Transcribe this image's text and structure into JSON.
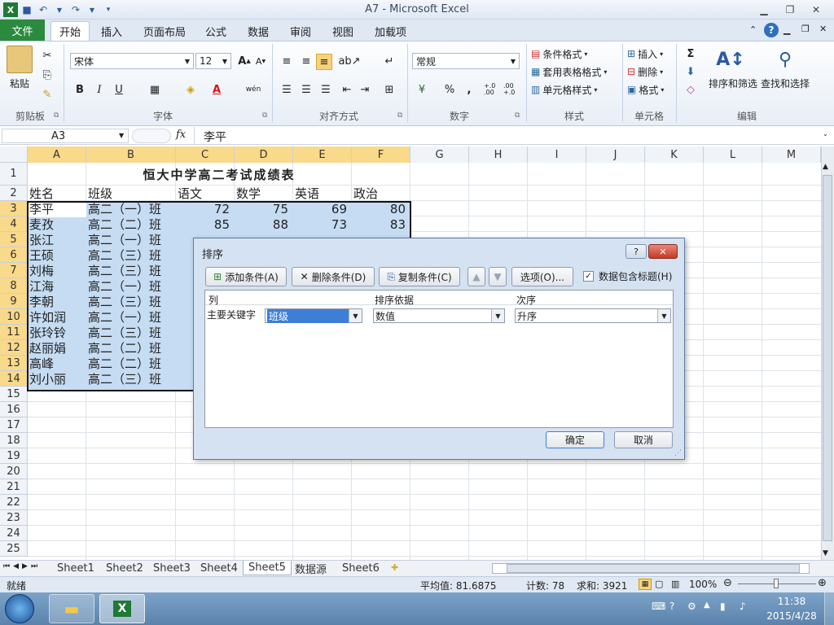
{
  "window": {
    "title": "A7 - Microsoft Excel"
  },
  "qat": {
    "save": "💾",
    "undo": "↶",
    "redo": "↷"
  },
  "tabs": {
    "file": "文件",
    "items": [
      "开始",
      "插入",
      "页面布局",
      "公式",
      "数据",
      "审阅",
      "视图",
      "加载项"
    ]
  },
  "ribbon": {
    "clipboard": {
      "label": "剪贴板",
      "paste": "粘贴"
    },
    "font": {
      "label": "字体",
      "name": "宋体",
      "size": "12",
      "grow": "A",
      "shrink": "A",
      "bold": "B",
      "italic": "I",
      "underline": "U",
      "pinyin": "wén"
    },
    "align": {
      "label": "对齐方式"
    },
    "number": {
      "label": "数字",
      "format": "常规",
      "percent": "%",
      "comma": ",",
      "inc_decimal": "+.0 .00",
      "dec_decimal": ".00 +.0"
    },
    "styles": {
      "label": "样式",
      "cond": "条件格式",
      "table": "套用表格格式",
      "cell": "单元格样式"
    },
    "cells": {
      "label": "单元格",
      "insert": "插入",
      "delete": "删除",
      "format": "格式"
    },
    "editing": {
      "label": "编辑",
      "sort": "排序和筛选",
      "find": "查找和选择",
      "sum": "Σ"
    }
  },
  "formula_bar": {
    "namebox": "A3",
    "fx": "fx",
    "content": "李平"
  },
  "columns": [
    "A",
    "B",
    "C",
    "D",
    "E",
    "F",
    "G",
    "H",
    "I",
    "J",
    "K",
    "L",
    "M"
  ],
  "rows": [
    "1",
    "2",
    "3",
    "4",
    "5",
    "6",
    "7",
    "8",
    "9",
    "10",
    "11",
    "12",
    "13",
    "14",
    "15",
    "16",
    "17",
    "18",
    "19",
    "20",
    "21",
    "22",
    "23",
    "24",
    "25"
  ],
  "sheet": {
    "title": "恒大中学高二考试成绩表",
    "headers": [
      "姓名",
      "班级",
      "语文",
      "数学",
      "英语",
      "政治"
    ],
    "data": [
      {
        "name": "李平",
        "class": "高二（一）班",
        "c": "72",
        "d": "75",
        "e": "69",
        "f": "80"
      },
      {
        "name": "麦孜",
        "class": "高二（二）班",
        "c": "85",
        "d": "88",
        "e": "73",
        "f": "83"
      },
      {
        "name": "张江",
        "class": "高二（一）班"
      },
      {
        "name": "王硕",
        "class": "高二（三）班"
      },
      {
        "name": "刘梅",
        "class": "高二（三）班"
      },
      {
        "name": "江海",
        "class": "高二（一）班"
      },
      {
        "name": "李朝",
        "class": "高二（三）班"
      },
      {
        "name": "许如润",
        "class": "高二（一）班"
      },
      {
        "name": "张玲铃",
        "class": "高二（三）班"
      },
      {
        "name": "赵丽娟",
        "class": "高二（二）班"
      },
      {
        "name": "高峰",
        "class": "高二（二）班"
      },
      {
        "name": "刘小丽",
        "class": "高二（三）班"
      }
    ]
  },
  "dialog": {
    "title": "排序",
    "help": "?",
    "close": "✕",
    "add": "添加条件(A)",
    "delete": "删除条件(D)",
    "copy": "复制条件(C)",
    "options": "选项(O)...",
    "has_header": "数据包含标题(H)",
    "col_header": "列",
    "basis_header": "排序依据",
    "order_header": "次序",
    "key_label": "主要关键字",
    "key_value": "班级",
    "basis_value": "数值",
    "order_value": "升序",
    "ok": "确定",
    "cancel": "取消"
  },
  "sheet_tabs": [
    "Sheet1",
    "Sheet2",
    "Sheet3",
    "Sheet4",
    "Sheet5",
    "数据源",
    "Sheet6"
  ],
  "active_sheet": "Sheet5",
  "status": {
    "ready": "就绪",
    "avg": "平均值: 81.6875",
    "count": "计数: 78",
    "sum": "求和: 3921",
    "zoom": "100%"
  },
  "taskbar": {
    "time": "11:38",
    "date": "2015/4/28"
  },
  "colors": {
    "accent": "#2b8a3e",
    "selection": "#c5dcf3",
    "header_sel": "#f9d98a"
  }
}
